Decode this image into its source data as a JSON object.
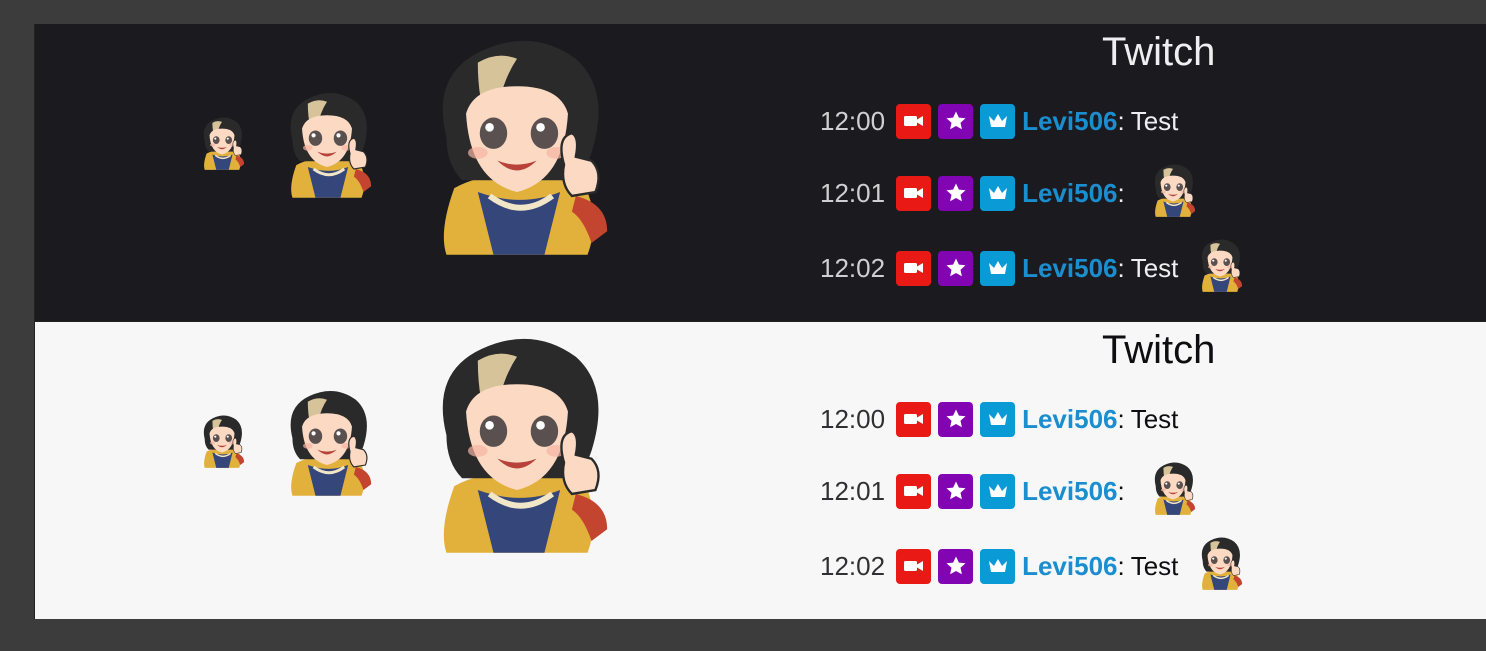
{
  "panels": [
    {
      "theme": "dark",
      "title": "Twitch",
      "messages": [
        {
          "time": "12:00",
          "user": "Levi506",
          "text": "Test",
          "emote": false
        },
        {
          "time": "12:01",
          "user": "Levi506",
          "text": "",
          "emote": true
        },
        {
          "time": "12:02",
          "user": "Levi506",
          "text": "Test",
          "emote": true
        }
      ]
    },
    {
      "theme": "light",
      "title": "Twitch",
      "messages": [
        {
          "time": "12:00",
          "user": "Levi506",
          "text": "Test",
          "emote": false
        },
        {
          "time": "12:01",
          "user": "Levi506",
          "text": "",
          "emote": true
        },
        {
          "time": "12:02",
          "user": "Levi506",
          "text": "Test",
          "emote": true
        }
      ]
    }
  ],
  "colors": {
    "dark_bg": "#1b1a1f",
    "light_bg": "#f7f7f8",
    "username": "#1b8ecf",
    "broadcaster_badge": "#e91916",
    "vip_badge": "#8205b4",
    "sub_badge": "#0a9ad6"
  },
  "icons": [
    "emote-preview-icon",
    "broadcaster-badge-icon",
    "vip-badge-icon",
    "subscriber-badge-icon"
  ]
}
